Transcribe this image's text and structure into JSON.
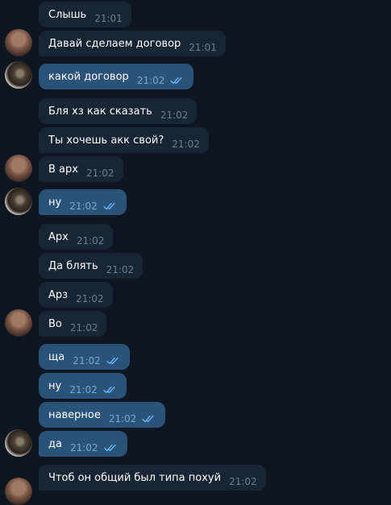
{
  "messages": [
    {
      "text": "Слышь",
      "time": "21:01",
      "dir": "in"
    },
    {
      "text": "Давай сделаем договор",
      "time": "21:01",
      "dir": "in"
    },
    {
      "text": "какой договор",
      "time": "21:02",
      "dir": "out"
    },
    {
      "text": "Бля хз как сказать",
      "time": "21:02",
      "dir": "in"
    },
    {
      "text": "Ты хочешь акк свой?",
      "time": "21:02",
      "dir": "in"
    },
    {
      "text": "В арх",
      "time": "21:02",
      "dir": "in"
    },
    {
      "text": "ну",
      "time": "21:02",
      "dir": "out"
    },
    {
      "text": "Арх",
      "time": "21:02",
      "dir": "in"
    },
    {
      "text": "Да блять",
      "time": "21:02",
      "dir": "in"
    },
    {
      "text": "Арз",
      "time": "21:02",
      "dir": "in"
    },
    {
      "text": "Во",
      "time": "21:02",
      "dir": "in"
    },
    {
      "text": "ща",
      "time": "21:02",
      "dir": "out"
    },
    {
      "text": "ну",
      "time": "21:02",
      "dir": "out"
    },
    {
      "text": "наверное",
      "time": "21:02",
      "dir": "out"
    },
    {
      "text": "да",
      "time": "21:02",
      "dir": "out"
    },
    {
      "text": "Чтоб он общий был типа похуй",
      "time": "21:02",
      "dir": "in"
    }
  ],
  "avatars": [
    {
      "kind": "contact-avatar"
    },
    {
      "kind": "own-avatar"
    },
    {
      "kind": "contact-avatar"
    },
    {
      "kind": "own-avatar"
    },
    {
      "kind": "contact-avatar"
    },
    {
      "kind": "own-avatar"
    },
    {
      "kind": "contact-avatar"
    }
  ],
  "colors": {
    "background": "#0e1621",
    "incoming_bubble": "#182533",
    "outgoing_bubble": "#2b5278",
    "read_checks": "#6ab2f2"
  },
  "read_icon": "double-check-icon"
}
